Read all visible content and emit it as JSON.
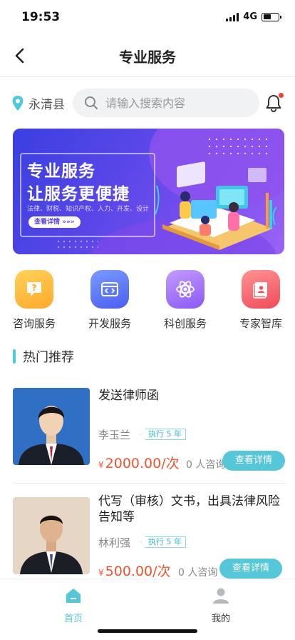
{
  "status_bar": {
    "time": "19:53",
    "network": "4G",
    "battery_level": 0.5
  },
  "nav": {
    "title": "专业服务",
    "back_icon": "chevron-left-icon"
  },
  "location": {
    "text": "永清县",
    "icon": "location-pin-icon"
  },
  "search": {
    "placeholder": "请输入搜索内容",
    "icon": "search-icon"
  },
  "notification": {
    "icon": "bell-icon",
    "has_unread_dot": true
  },
  "banner": {
    "title_line1": "专业服务",
    "title_line2": "让服务更便捷",
    "subtitle": "法律、财税、知识产权、人力、开发、设计",
    "button_label": "查看详情 »»»"
  },
  "categories": [
    {
      "label": "咨询服务",
      "icon": "question-chat-icon",
      "color_from": "#ffd25a",
      "color_to": "#ffb22e"
    },
    {
      "label": "开发服务",
      "icon": "code-window-icon",
      "color_from": "#6f8dff",
      "color_to": "#4a62f0"
    },
    {
      "label": "科创服务",
      "icon": "atom-icon",
      "color_from": "#b88bff",
      "color_to": "#8d5cf5"
    },
    {
      "label": "专家智库",
      "icon": "expert-book-icon",
      "color_from": "#ff8a8a",
      "color_to": "#f0525e"
    }
  ],
  "section": {
    "title": "热门推荐"
  },
  "recommendations": [
    {
      "title": "发送律师函",
      "name": "李玉兰",
      "tag": "执行 5 年",
      "currency": "¥",
      "price": "2000.00/次",
      "consult": "0 人咨询",
      "button_label": "查看详情"
    },
    {
      "title": "代写（审核）文书，出具法律风险告知等",
      "name": "林利强",
      "tag": "执行 5 年",
      "currency": "¥",
      "price": "500.00/次",
      "consult": "0 人咨询",
      "button_label": "查看详情"
    }
  ],
  "tabbar": {
    "items": [
      {
        "label": "首页",
        "icon": "home-icon",
        "active": true
      },
      {
        "label": "我的",
        "icon": "user-icon",
        "active": false
      }
    ]
  },
  "colors": {
    "accent": "#4fc9dd",
    "price": "#f0542d",
    "banner": "#5a47e8"
  }
}
